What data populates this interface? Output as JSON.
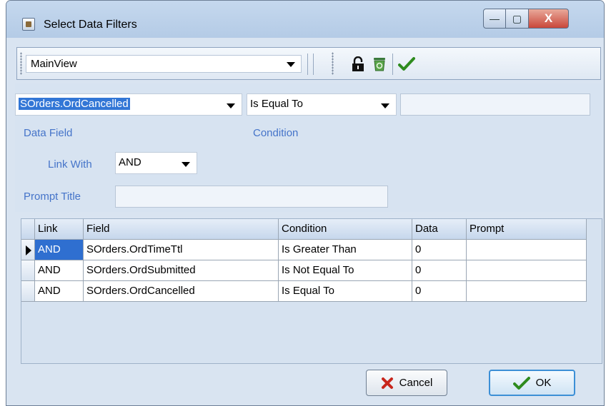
{
  "window": {
    "title": "Select Data Filters",
    "minimize": "—",
    "maximize": "▢",
    "close": "X"
  },
  "toolbar": {
    "view_value": "MainView",
    "icons": [
      "lock-icon",
      "recycle-bin-icon",
      "checkmark-icon"
    ]
  },
  "filter": {
    "data_field_value": "SOrders.OrdCancelled",
    "data_field_label": "Data Field",
    "condition_value": "Is Equal To",
    "condition_label": "Condition",
    "data_value": "",
    "link_with_label": "Link With",
    "link_with_value": "AND",
    "prompt_title_label": "Prompt Title",
    "prompt_title_value": ""
  },
  "grid": {
    "headers": [
      "Link",
      "Field",
      "Condition",
      "Data",
      "Prompt"
    ],
    "rows": [
      {
        "link": "AND",
        "field": "SOrders.OrdTimeTtl",
        "condition": "Is Greater Than",
        "data": "0",
        "prompt": ""
      },
      {
        "link": "AND",
        "field": "SOrders.OrdSubmitted",
        "condition": "Is Not Equal To",
        "data": "0",
        "prompt": ""
      },
      {
        "link": "AND",
        "field": "SOrders.OrdCancelled",
        "condition": "Is Equal To",
        "data": "0",
        "prompt": ""
      }
    ],
    "active_row": 0
  },
  "buttons": {
    "cancel_label": "Cancel",
    "ok_label": "OK"
  },
  "colors": {
    "label_blue": "#4574c9",
    "selection": "#2f6fd0",
    "cancel_x": "#c8261c",
    "ok_check": "#2e8b1e"
  }
}
